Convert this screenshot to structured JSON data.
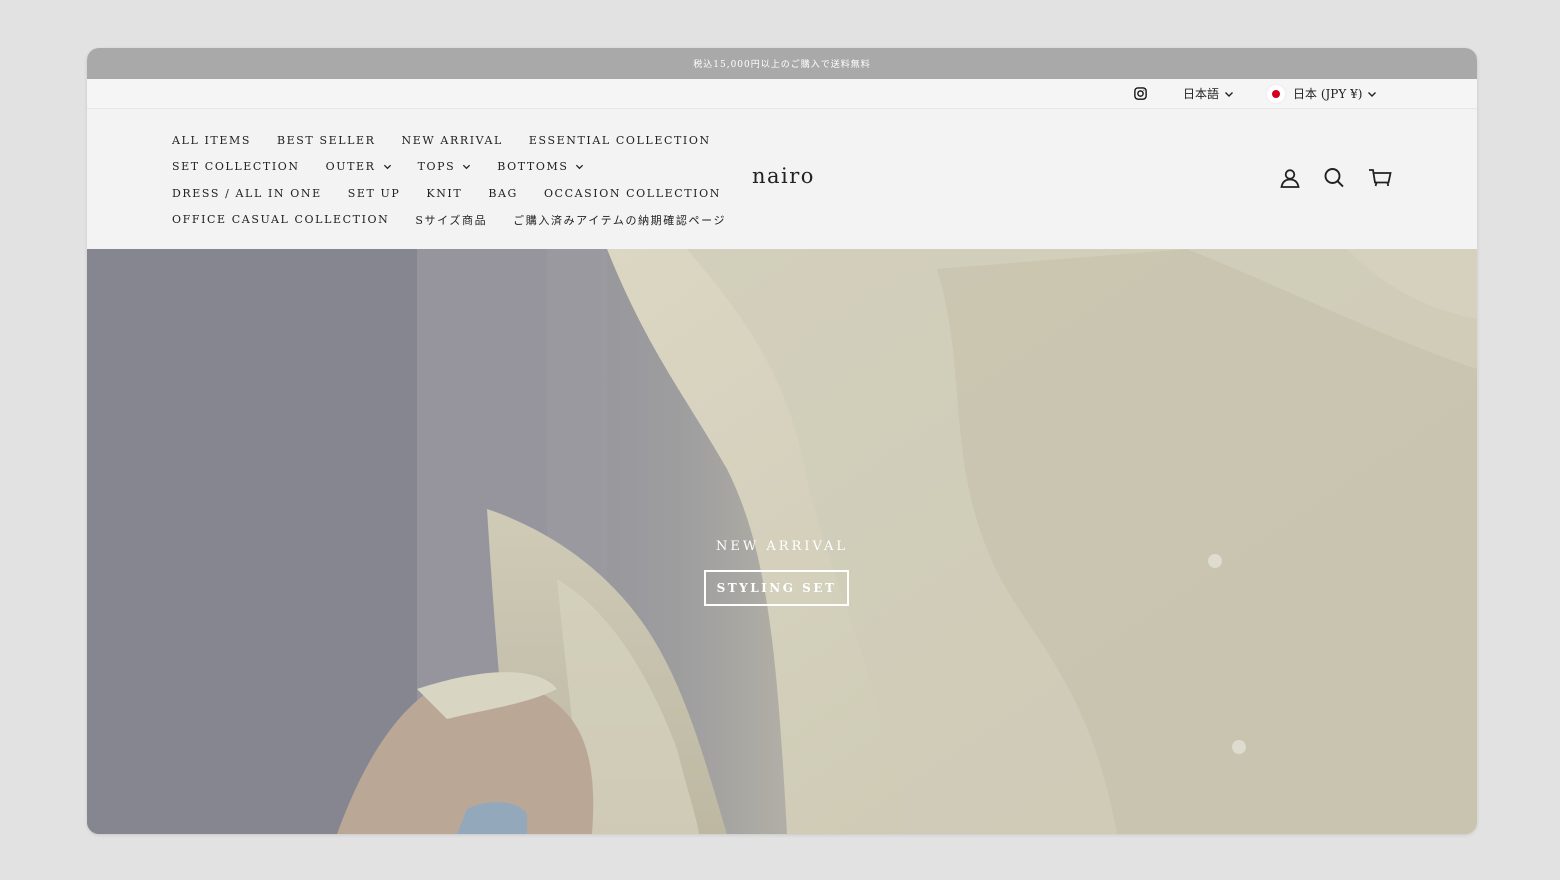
{
  "announcement": "税込15,000円以上のご購入で送料無料",
  "utility": {
    "instagram_icon": "instagram-icon",
    "language": "日本語",
    "currency": "日本 (JPY ¥)"
  },
  "nav": {
    "rows": [
      [
        {
          "label": "ALL ITEMS",
          "dropdown": false
        },
        {
          "label": "BEST SELLER",
          "dropdown": false
        },
        {
          "label": "NEW ARRIVAL",
          "dropdown": false
        },
        {
          "label": "ESSENTIAL COLLECTION",
          "dropdown": false
        }
      ],
      [
        {
          "label": "SET COLLECTION",
          "dropdown": false
        },
        {
          "label": "OUTER",
          "dropdown": true
        },
        {
          "label": "TOPS",
          "dropdown": true
        },
        {
          "label": "BOTTOMS",
          "dropdown": true
        }
      ],
      [
        {
          "label": "DRESS / ALL IN ONE",
          "dropdown": false
        },
        {
          "label": "SET UP",
          "dropdown": false
        },
        {
          "label": "KNIT",
          "dropdown": false
        },
        {
          "label": "BAG",
          "dropdown": false
        },
        {
          "label": "OCCASION COLLECTION",
          "dropdown": false
        }
      ],
      [
        {
          "label": "OFFICE CASUAL COLLECTION",
          "dropdown": false
        },
        {
          "label": "Sサイズ商品",
          "dropdown": false
        },
        {
          "label": "ご購入済みアイテムの納期確認ページ",
          "dropdown": false
        }
      ]
    ]
  },
  "logo": "nairo",
  "header_icons": [
    "account-icon",
    "search-icon",
    "cart-icon"
  ],
  "hero": {
    "subtitle": "NEW ARRIVAL",
    "button_label": "STYLING SET"
  },
  "colors": {
    "announcement_bg": "#a9a9a9",
    "header_bg": "#f3f3f3",
    "text": "#222222",
    "hero_text": "#ffffff"
  }
}
